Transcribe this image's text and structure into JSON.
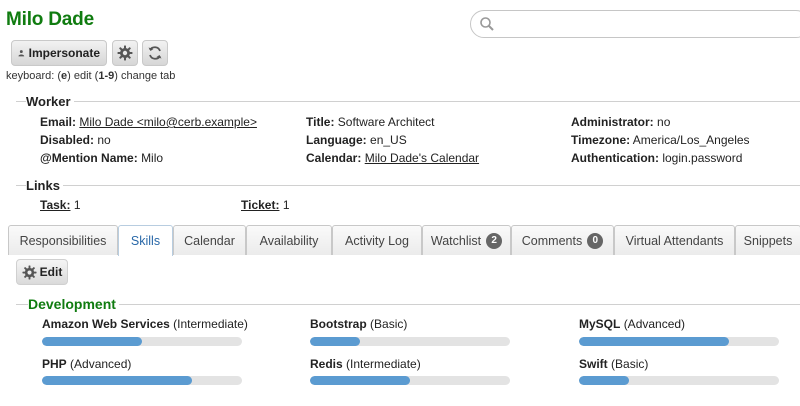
{
  "worker_name": "Milo Dade",
  "toolbar": {
    "impersonate_label": "Impersonate",
    "hint_prefix": "keyboard: (",
    "hint_key1": "e",
    "hint_mid": ") edit (",
    "hint_key2": "1-9",
    "hint_suffix": ") change tab"
  },
  "search": {
    "placeholder": ""
  },
  "worker_section": {
    "title": "Worker",
    "email_label": "Email:",
    "email_value": "Milo Dade <milo@cerb.example>",
    "disabled_label": "Disabled:",
    "disabled_value": "no",
    "mention_label": "@Mention Name:",
    "mention_value": "Milo",
    "title_label": "Title:",
    "title_value": "Software Architect",
    "language_label": "Language:",
    "language_value": "en_US",
    "calendar_label": "Calendar:",
    "calendar_value": "Milo Dade's Calendar",
    "admin_label": "Administrator:",
    "admin_value": "no",
    "timezone_label": "Timezone:",
    "timezone_value": "America/Los_Angeles",
    "auth_label": "Authentication:",
    "auth_value": "login.password"
  },
  "links_section": {
    "title": "Links",
    "task_label": "Task:",
    "task_count": "1",
    "ticket_label": "Ticket:",
    "ticket_count": "1"
  },
  "tabs": [
    {
      "label": "Responsibilities"
    },
    {
      "label": "Skills"
    },
    {
      "label": "Calendar"
    },
    {
      "label": "Availability"
    },
    {
      "label": "Activity Log"
    },
    {
      "label": "Watchlist",
      "badge": "2"
    },
    {
      "label": "Comments",
      "badge": "0"
    },
    {
      "label": "Virtual Attendants"
    },
    {
      "label": "Snippets"
    }
  ],
  "active_tab": "Skills",
  "skills_panel": {
    "edit_label": "Edit",
    "group_title": "Development",
    "skills": [
      {
        "name": "Amazon Web Services",
        "level": "(Intermediate)",
        "fraction": 0.5
      },
      {
        "name": "Bootstrap",
        "level": "(Basic)",
        "fraction": 0.25
      },
      {
        "name": "MySQL",
        "level": "(Advanced)",
        "fraction": 0.75
      },
      {
        "name": "PHP",
        "level": "(Advanced)",
        "fraction": 0.75
      },
      {
        "name": "Redis",
        "level": "(Intermediate)",
        "fraction": 0.5
      },
      {
        "name": "Swift",
        "level": "(Basic)",
        "fraction": 0.25
      }
    ]
  },
  "colors": {
    "title_green": "#107c10",
    "active_tab_blue": "#2968a8",
    "skill_bar": "#5b9bd1",
    "skill_track": "#e3e3e3"
  }
}
